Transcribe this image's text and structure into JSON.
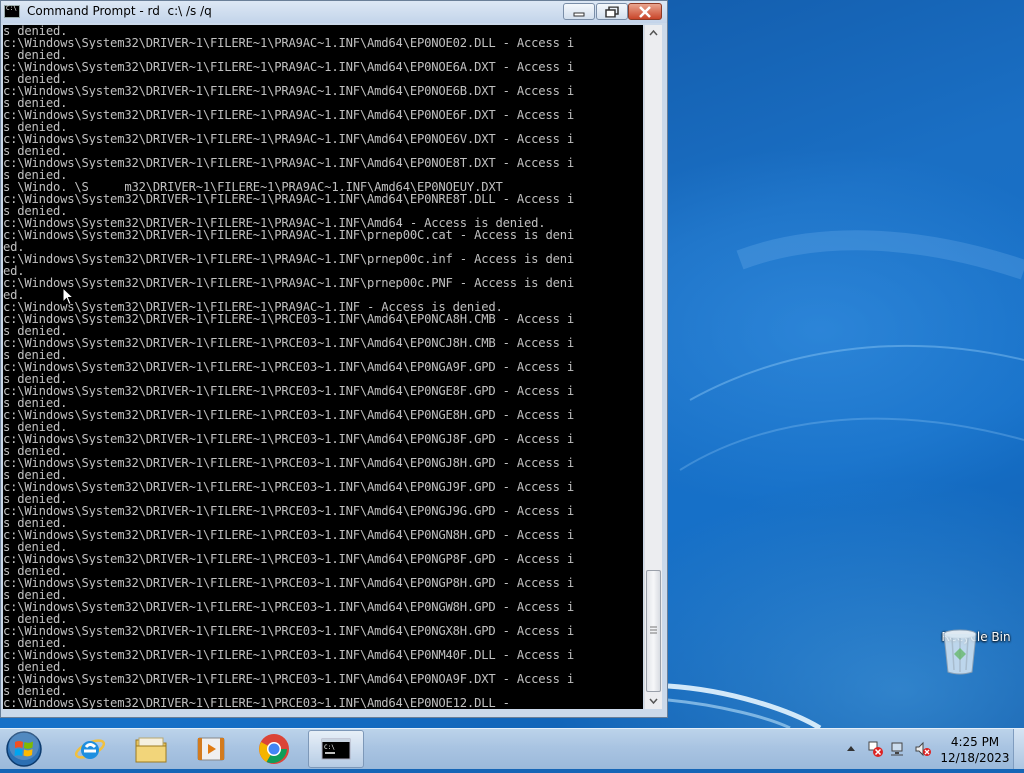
{
  "window": {
    "title": "Command Prompt - rd  c:\\ /s /q",
    "icon": "cmd-icon",
    "buttons": {
      "minimize": "minimize-icon",
      "maximize": "maximize-icon",
      "close": "close-icon"
    }
  },
  "console": {
    "lines": [
      "s denied.",
      "c:\\Windows\\System32\\DRIVER~1\\FILERE~1\\PRA9AC~1.INF\\Amd64\\EP0NOE02.DLL - Access i",
      "s denied.",
      "c:\\Windows\\System32\\DRIVER~1\\FILERE~1\\PRA9AC~1.INF\\Amd64\\EP0NOE6A.DXT - Access i",
      "s denied.",
      "c:\\Windows\\System32\\DRIVER~1\\FILERE~1\\PRA9AC~1.INF\\Amd64\\EP0NOE6B.DXT - Access i",
      "s denied.",
      "c:\\Windows\\System32\\DRIVER~1\\FILERE~1\\PRA9AC~1.INF\\Amd64\\EP0NOE6F.DXT - Access i",
      "s denied.",
      "c:\\Windows\\System32\\DRIVER~1\\FILERE~1\\PRA9AC~1.INF\\Amd64\\EP0NOE6V.DXT - Access i",
      "s denied.",
      "c:\\Windows\\System32\\DRIVER~1\\FILERE~1\\PRA9AC~1.INF\\Amd64\\EP0NOE8T.DXT - Access i",
      "s denied.",
      "s \\Windo. \\S     m32\\DRIVER~1\\FILERE~1\\PRA9AC~1.INF\\Amd64\\EP0NOEUY.DXT",
      "c:\\Windows\\System32\\DRIVER~1\\FILERE~1\\PRA9AC~1.INF\\Amd64\\EP0NRE8T.DLL - Access i",
      "s denied.",
      "c:\\Windows\\System32\\DRIVER~1\\FILERE~1\\PRA9AC~1.INF\\Amd64 - Access is denied.",
      "c:\\Windows\\System32\\DRIVER~1\\FILERE~1\\PRA9AC~1.INF\\prnep00C.cat - Access is deni",
      "ed.",
      "c:\\Windows\\System32\\DRIVER~1\\FILERE~1\\PRA9AC~1.INF\\prnep00c.inf - Access is deni",
      "ed.",
      "c:\\Windows\\System32\\DRIVER~1\\FILERE~1\\PRA9AC~1.INF\\prnep00c.PNF - Access is deni",
      "ed.",
      "c:\\Windows\\System32\\DRIVER~1\\FILERE~1\\PRA9AC~1.INF - Access is denied.",
      "c:\\Windows\\System32\\DRIVER~1\\FILERE~1\\PRCE03~1.INF\\Amd64\\EP0NCA8H.CMB - Access i",
      "s denied.",
      "c:\\Windows\\System32\\DRIVER~1\\FILERE~1\\PRCE03~1.INF\\Amd64\\EP0NCJ8H.CMB - Access i",
      "s denied.",
      "c:\\Windows\\System32\\DRIVER~1\\FILERE~1\\PRCE03~1.INF\\Amd64\\EP0NGA9F.GPD - Access i",
      "s denied.",
      "c:\\Windows\\System32\\DRIVER~1\\FILERE~1\\PRCE03~1.INF\\Amd64\\EP0NGE8F.GPD - Access i",
      "s denied.",
      "c:\\Windows\\System32\\DRIVER~1\\FILERE~1\\PRCE03~1.INF\\Amd64\\EP0NGE8H.GPD - Access i",
      "s denied.",
      "c:\\Windows\\System32\\DRIVER~1\\FILERE~1\\PRCE03~1.INF\\Amd64\\EP0NGJ8F.GPD - Access i",
      "s denied.",
      "c:\\Windows\\System32\\DRIVER~1\\FILERE~1\\PRCE03~1.INF\\Amd64\\EP0NGJ8H.GPD - Access i",
      "s denied.",
      "c:\\Windows\\System32\\DRIVER~1\\FILERE~1\\PRCE03~1.INF\\Amd64\\EP0NGJ9F.GPD - Access i",
      "s denied.",
      "c:\\Windows\\System32\\DRIVER~1\\FILERE~1\\PRCE03~1.INF\\Amd64\\EP0NGJ9G.GPD - Access i",
      "s denied.",
      "c:\\Windows\\System32\\DRIVER~1\\FILERE~1\\PRCE03~1.INF\\Amd64\\EP0NGN8H.GPD - Access i",
      "s denied.",
      "c:\\Windows\\System32\\DRIVER~1\\FILERE~1\\PRCE03~1.INF\\Amd64\\EP0NGP8F.GPD - Access i",
      "s denied.",
      "c:\\Windows\\System32\\DRIVER~1\\FILERE~1\\PRCE03~1.INF\\Amd64\\EP0NGP8H.GPD - Access i",
      "s denied.",
      "c:\\Windows\\System32\\DRIVER~1\\FILERE~1\\PRCE03~1.INF\\Amd64\\EP0NGW8H.GPD - Access i",
      "s denied.",
      "c:\\Windows\\System32\\DRIVER~1\\FILERE~1\\PRCE03~1.INF\\Amd64\\EP0NGX8H.GPD - Access i",
      "s denied.",
      "c:\\Windows\\System32\\DRIVER~1\\FILERE~1\\PRCE03~1.INF\\Amd64\\EP0NM40F.DLL - Access i",
      "s denied.",
      "c:\\Windows\\System32\\DRIVER~1\\FILERE~1\\PRCE03~1.INF\\Amd64\\EP0NOA9F.DXT - Access i",
      "s denied.",
      "c:\\Windows\\System32\\DRIVER~1\\FILERE~1\\PRCE03~1.INF\\Amd64\\EP0NOE12.DLL -"
    ]
  },
  "desktop": {
    "icons": [
      {
        "label": "Recycle Bin",
        "icon": "recycle-bin-icon"
      }
    ]
  },
  "taskbar": {
    "start": "windows-logo-icon",
    "pinned": [
      {
        "name": "Internet Explorer",
        "icon": "ie-icon"
      },
      {
        "name": "Windows Explorer",
        "icon": "folder-icon"
      },
      {
        "name": "Windows Media Player",
        "icon": "media-player-icon"
      },
      {
        "name": "Google Chrome",
        "icon": "chrome-icon"
      },
      {
        "name": "Command Prompt",
        "icon": "cmd-icon",
        "active": true
      }
    ],
    "tray": {
      "icons": [
        "show-hidden-icons-icon",
        "action-center-icon",
        "network-icon",
        "volume-icon"
      ],
      "time": "4:25 PM",
      "date": "12/18/2023"
    }
  },
  "colors": {
    "console_bg": "#000000",
    "console_text": "#c0c0c0",
    "desktop_blue": "#1a6fc4",
    "close_button": "#c9452a"
  }
}
